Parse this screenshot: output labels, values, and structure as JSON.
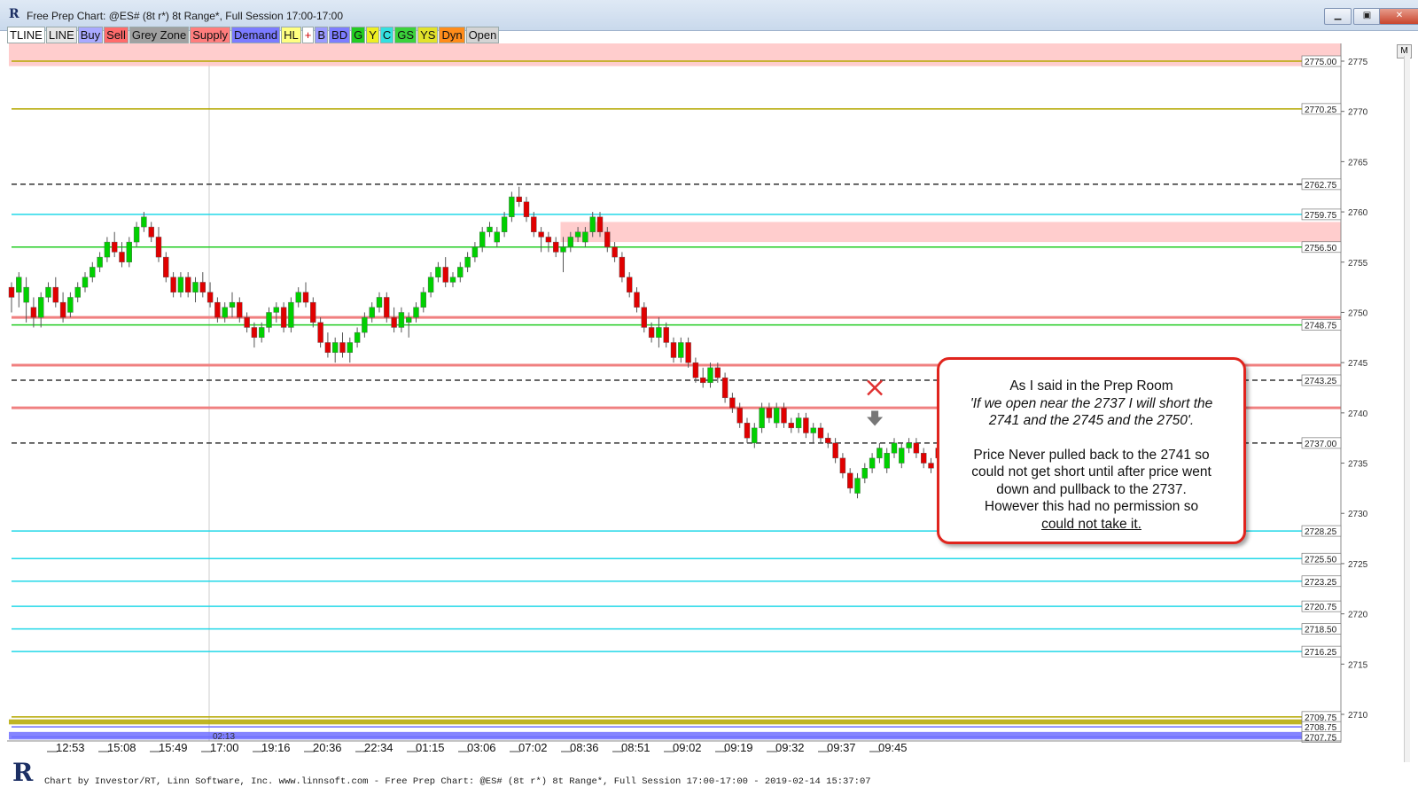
{
  "window": {
    "title": "Free Prep Chart: @ES# (8t r*) 8t Range*, Full Session 17:00-17:00",
    "minimize_label": "▁",
    "maximize_label": "▣",
    "close_label": "✕"
  },
  "toolbar": [
    {
      "label": "TLINE",
      "bg": "#ffffff"
    },
    {
      "label": "LINE",
      "bg": "#e6e6e6"
    },
    {
      "label": "Buy",
      "bg": "#a9a9ff"
    },
    {
      "label": "Sell",
      "bg": "#ff6b6b"
    },
    {
      "label": "Grey Zone",
      "bg": "#a0a0a0"
    },
    {
      "label": "Supply",
      "bg": "#ff7d7d"
    },
    {
      "label": "Demand",
      "bg": "#7b7bff"
    },
    {
      "label": "HL",
      "bg": "#ffff80"
    },
    {
      "label": "+",
      "bg": "#ffffff",
      "fg": "#d00000"
    },
    {
      "label": "B",
      "bg": "#9a9aff"
    },
    {
      "label": "BD",
      "bg": "#7d7dff"
    },
    {
      "label": "G",
      "bg": "#22cc22"
    },
    {
      "label": "Y",
      "bg": "#eeee22"
    },
    {
      "label": "C",
      "bg": "#33e0e0"
    },
    {
      "label": "GS",
      "bg": "#3bd23b"
    },
    {
      "label": "YS",
      "bg": "#e2e22a"
    },
    {
      "label": "Dyn",
      "bg": "#ff8c1a"
    },
    {
      "label": "Open",
      "bg": "#d4d4d4"
    }
  ],
  "m_button": "M",
  "callout": {
    "line1": "As I said in the Prep Room",
    "line2": "'If we open near the 2737 I will short the",
    "line3": "2741 and the 2745 and the 2750'.",
    "line4": "Price Never pulled back to the 2741 so",
    "line5": "could not get short until after price went",
    "line6": "down and pullback to the 2737.",
    "line7": "However this had no permission so",
    "line8": "could not take it."
  },
  "footer": "Chart by Investor/RT, Linn Software, Inc. www.linnsoft.com - Free Prep Chart: @ES# (8t r*) 8t Range*, Full Session 17:00-17:00 - 2019-02-14 15:37:07",
  "chart_data": {
    "type": "candlestick",
    "symbol": "@ES#",
    "ylim": [
      2707,
      2777.5
    ],
    "y_ticks": [
      2710,
      2715,
      2720,
      2725,
      2730,
      2735,
      2740,
      2745,
      2750,
      2755,
      2760,
      2765,
      2770,
      2775
    ],
    "x_tick_labels": [
      "12:53",
      "15:08",
      "15:49",
      "17:00",
      "19:16",
      "20:36",
      "22:34",
      "01:15",
      "03:06",
      "07:02",
      "08:36",
      "08:51",
      "09:02",
      "09:19",
      "09:32",
      "09:37",
      "09:45"
    ],
    "session_marker_label": "02:13",
    "colors": {
      "up": "#00d000",
      "down": "#e00000",
      "wick": "#555555"
    },
    "levels": [
      {
        "price": 2775.0,
        "label": "2775.00",
        "color": "#b5a800",
        "style": "solid"
      },
      {
        "price": 2770.25,
        "label": "2770.25",
        "color": "#b5a800",
        "style": "solid"
      },
      {
        "price": 2762.75,
        "label": "2762.75",
        "color": "#333333",
        "style": "dashed"
      },
      {
        "price": 2759.75,
        "label": "2759.75",
        "color": "#22d8e8",
        "style": "solid"
      },
      {
        "price": 2756.5,
        "label": "2756.50",
        "color": "#333333",
        "style": "dashed"
      },
      {
        "price": 2756.5,
        "label": "",
        "color": "#22cc22",
        "style": "solid"
      },
      {
        "price": 2749.5,
        "label": "",
        "color": "#f08080",
        "style": "solid"
      },
      {
        "price": 2748.75,
        "label": "2748.75",
        "color": "#22cc22",
        "style": "solid"
      },
      {
        "price": 2744.75,
        "label": "",
        "color": "#f08080",
        "style": "solid"
      },
      {
        "price": 2743.25,
        "label": "2743.25",
        "color": "#333333",
        "style": "dashed"
      },
      {
        "price": 2740.5,
        "label": "",
        "color": "#f08080",
        "style": "solid"
      },
      {
        "price": 2737.0,
        "label": "2737.00",
        "color": "#333333",
        "style": "dashed"
      },
      {
        "price": 2728.25,
        "label": "2728.25",
        "color": "#22d8e8",
        "style": "solid"
      },
      {
        "price": 2725.5,
        "label": "2725.50",
        "color": "#22d8e8",
        "style": "solid"
      },
      {
        "price": 2723.25,
        "label": "2723.25",
        "color": "#22d8e8",
        "style": "solid"
      },
      {
        "price": 2720.75,
        "label": "2720.75",
        "color": "#22d8e8",
        "style": "solid"
      },
      {
        "price": 2718.5,
        "label": "2718.50",
        "color": "#22d8e8",
        "style": "solid"
      },
      {
        "price": 2716.25,
        "label": "2716.25",
        "color": "#22d8e8",
        "style": "solid"
      },
      {
        "price": 2709.75,
        "label": "2709.75",
        "color": "#b5a800",
        "style": "solid"
      },
      {
        "price": 2708.75,
        "label": "2708.75",
        "color": "#6e6eff",
        "style": "solid"
      },
      {
        "price": 2707.75,
        "label": "2707.75",
        "color": "#6e6eff",
        "style": "solid"
      }
    ],
    "zones": [
      {
        "from": 2774.5,
        "to": 2777.5,
        "color": "#ffc4c4",
        "start_index": 0
      },
      {
        "from": 2757.0,
        "to": 2759.0,
        "color": "#ffc4c4",
        "start_index": 75
      },
      {
        "from": 2707.5,
        "to": 2708.25,
        "color": "#6e6eff",
        "start_index": 0
      },
      {
        "from": 2709.0,
        "to": 2709.5,
        "color": "#b5a800",
        "start_index": 0
      }
    ],
    "annotations": [
      {
        "type": "x-mark",
        "price": 2742.5,
        "bar_index": 117,
        "color": "#e03030"
      },
      {
        "type": "down-arrow",
        "price": 2739.5,
        "bar_index": 117,
        "color": "#777777"
      }
    ],
    "candles": [
      [
        2752.5,
        2753.0,
        2750.0,
        2751.5
      ],
      [
        2752.0,
        2754.0,
        2750.5,
        2753.5
      ],
      [
        2751.0,
        2753.5,
        2749.0,
        2752.5
      ],
      [
        2750.5,
        2751.5,
        2748.5,
        2749.5
      ],
      [
        2749.5,
        2752.0,
        2748.5,
        2751.5
      ],
      [
        2751.5,
        2753.0,
        2751.0,
        2752.5
      ],
      [
        2752.5,
        2753.5,
        2750.5,
        2751.0
      ],
      [
        2751.0,
        2752.0,
        2749.0,
        2749.5
      ],
      [
        2750.0,
        2752.0,
        2749.5,
        2751.5
      ],
      [
        2751.5,
        2753.0,
        2751.0,
        2752.5
      ],
      [
        2752.5,
        2754.0,
        2752.0,
        2753.5
      ],
      [
        2753.5,
        2755.0,
        2753.0,
        2754.5
      ],
      [
        2754.5,
        2756.0,
        2754.0,
        2755.5
      ],
      [
        2755.5,
        2757.5,
        2755.0,
        2757.0
      ],
      [
        2757.0,
        2758.0,
        2755.5,
        2756.0
      ],
      [
        2756.0,
        2757.0,
        2754.5,
        2755.0
      ],
      [
        2755.0,
        2757.5,
        2754.5,
        2757.0
      ],
      [
        2757.0,
        2759.0,
        2756.5,
        2758.5
      ],
      [
        2758.5,
        2760.0,
        2758.0,
        2759.5
      ],
      [
        2758.5,
        2759.0,
        2757.0,
        2757.5
      ],
      [
        2757.5,
        2758.5,
        2755.0,
        2755.5
      ],
      [
        2755.5,
        2756.0,
        2753.0,
        2753.5
      ],
      [
        2753.5,
        2754.0,
        2751.5,
        2752.0
      ],
      [
        2752.0,
        2754.0,
        2751.5,
        2753.5
      ],
      [
        2753.5,
        2754.0,
        2751.5,
        2752.0
      ],
      [
        2752.0,
        2753.5,
        2751.0,
        2753.0
      ],
      [
        2753.0,
        2754.0,
        2751.5,
        2752.0
      ],
      [
        2752.0,
        2753.0,
        2750.5,
        2751.0
      ],
      [
        2751.0,
        2751.5,
        2749.0,
        2749.5
      ],
      [
        2749.5,
        2751.0,
        2749.0,
        2750.5
      ],
      [
        2750.5,
        2752.0,
        2749.5,
        2751.0
      ],
      [
        2751.0,
        2751.5,
        2749.0,
        2749.5
      ],
      [
        2749.5,
        2750.0,
        2748.0,
        2748.5
      ],
      [
        2748.5,
        2749.0,
        2746.5,
        2747.5
      ],
      [
        2747.5,
        2749.0,
        2747.0,
        2748.5
      ],
      [
        2748.5,
        2750.5,
        2748.0,
        2750.0
      ],
      [
        2750.0,
        2751.0,
        2749.0,
        2750.5
      ],
      [
        2750.5,
        2751.0,
        2748.0,
        2748.5
      ],
      [
        2748.5,
        2751.5,
        2748.0,
        2751.0
      ],
      [
        2751.0,
        2752.5,
        2750.5,
        2752.0
      ],
      [
        2752.0,
        2753.0,
        2750.5,
        2751.0
      ],
      [
        2751.0,
        2751.5,
        2748.5,
        2749.0
      ],
      [
        2749.0,
        2749.5,
        2746.5,
        2747.0
      ],
      [
        2747.0,
        2748.0,
        2745.5,
        2746.0
      ],
      [
        2746.0,
        2747.5,
        2745.0,
        2747.0
      ],
      [
        2747.0,
        2748.0,
        2745.5,
        2746.0
      ],
      [
        2746.0,
        2747.5,
        2745.0,
        2747.0
      ],
      [
        2747.0,
        2748.5,
        2746.5,
        2748.0
      ],
      [
        2748.0,
        2750.0,
        2747.5,
        2749.5
      ],
      [
        2749.5,
        2751.0,
        2749.0,
        2750.5
      ],
      [
        2750.5,
        2752.0,
        2750.0,
        2751.5
      ],
      [
        2751.5,
        2752.0,
        2749.0,
        2749.5
      ],
      [
        2749.5,
        2750.5,
        2748.0,
        2748.5
      ],
      [
        2748.5,
        2750.5,
        2748.0,
        2750.0
      ],
      [
        2749.0,
        2750.0,
        2747.5,
        2749.5
      ],
      [
        2749.5,
        2751.0,
        2749.0,
        2750.5
      ],
      [
        2750.5,
        2752.5,
        2750.0,
        2752.0
      ],
      [
        2752.0,
        2754.0,
        2751.5,
        2753.5
      ],
      [
        2753.5,
        2755.0,
        2753.0,
        2754.5
      ],
      [
        2754.5,
        2755.5,
        2752.5,
        2753.0
      ],
      [
        2753.0,
        2754.0,
        2752.5,
        2753.5
      ],
      [
        2753.5,
        2755.0,
        2753.0,
        2754.5
      ],
      [
        2754.5,
        2756.0,
        2754.0,
        2755.5
      ],
      [
        2755.5,
        2757.0,
        2755.0,
        2756.5
      ],
      [
        2756.5,
        2758.5,
        2756.0,
        2758.0
      ],
      [
        2758.0,
        2759.0,
        2757.5,
        2758.5
      ],
      [
        2757.0,
        2758.5,
        2756.5,
        2758.0
      ],
      [
        2758.0,
        2760.0,
        2757.5,
        2759.5
      ],
      [
        2759.5,
        2762.0,
        2759.0,
        2761.5
      ],
      [
        2761.5,
        2762.5,
        2760.5,
        2761.0
      ],
      [
        2761.0,
        2761.5,
        2759.0,
        2759.5
      ],
      [
        2759.5,
        2760.0,
        2757.5,
        2758.0
      ],
      [
        2758.0,
        2758.5,
        2756.0,
        2757.5
      ],
      [
        2757.5,
        2758.0,
        2756.0,
        2757.0
      ],
      [
        2757.0,
        2757.5,
        2755.5,
        2756.0
      ],
      [
        2756.0,
        2757.5,
        2754.0,
        2756.5
      ],
      [
        2756.5,
        2758.0,
        2756.0,
        2757.5
      ],
      [
        2757.5,
        2758.5,
        2757.0,
        2758.0
      ],
      [
        2757.0,
        2758.5,
        2756.5,
        2758.0
      ],
      [
        2758.0,
        2760.0,
        2757.5,
        2759.5
      ],
      [
        2759.5,
        2760.0,
        2757.5,
        2758.0
      ],
      [
        2758.0,
        2758.5,
        2756.0,
        2756.5
      ],
      [
        2756.5,
        2757.0,
        2755.0,
        2755.5
      ],
      [
        2755.5,
        2756.0,
        2753.0,
        2753.5
      ],
      [
        2753.5,
        2754.0,
        2751.5,
        2752.0
      ],
      [
        2752.0,
        2752.5,
        2750.0,
        2750.5
      ],
      [
        2750.5,
        2751.0,
        2748.0,
        2748.5
      ],
      [
        2748.5,
        2749.0,
        2747.0,
        2747.5
      ],
      [
        2747.5,
        2749.5,
        2746.5,
        2748.5
      ],
      [
        2748.5,
        2749.0,
        2746.5,
        2747.0
      ],
      [
        2747.0,
        2747.5,
        2745.0,
        2745.5
      ],
      [
        2745.5,
        2747.5,
        2745.0,
        2747.0
      ],
      [
        2747.0,
        2747.5,
        2744.5,
        2745.0
      ],
      [
        2745.0,
        2745.5,
        2743.0,
        2743.5
      ],
      [
        2743.5,
        2744.5,
        2742.5,
        2743.0
      ],
      [
        2743.0,
        2745.0,
        2742.5,
        2744.5
      ],
      [
        2744.5,
        2745.0,
        2743.0,
        2743.5
      ],
      [
        2743.5,
        2744.0,
        2741.0,
        2741.5
      ],
      [
        2741.5,
        2742.0,
        2740.0,
        2740.5
      ],
      [
        2740.5,
        2741.0,
        2738.5,
        2739.0
      ],
      [
        2739.0,
        2739.5,
        2737.0,
        2737.5
      ],
      [
        2737.0,
        2739.0,
        2736.5,
        2738.5
      ],
      [
        2738.5,
        2741.0,
        2738.0,
        2740.5
      ],
      [
        2740.5,
        2741.0,
        2739.0,
        2739.5
      ],
      [
        2739.0,
        2741.0,
        2738.5,
        2740.5
      ],
      [
        2740.5,
        2741.0,
        2738.5,
        2739.0
      ],
      [
        2739.0,
        2739.5,
        2738.0,
        2738.5
      ],
      [
        2738.5,
        2740.0,
        2738.0,
        2739.5
      ],
      [
        2739.5,
        2740.0,
        2737.5,
        2738.0
      ],
      [
        2738.0,
        2739.0,
        2737.0,
        2738.5
      ],
      [
        2738.5,
        2739.0,
        2737.0,
        2737.5
      ],
      [
        2737.5,
        2738.0,
        2736.5,
        2737.0
      ],
      [
        2737.0,
        2737.5,
        2735.0,
        2735.5
      ],
      [
        2735.5,
        2736.0,
        2733.5,
        2734.0
      ],
      [
        2734.0,
        2734.5,
        2732.0,
        2732.5
      ],
      [
        2732.0,
        2734.0,
        2731.5,
        2733.5
      ],
      [
        2733.5,
        2735.0,
        2733.0,
        2734.5
      ],
      [
        2734.5,
        2736.0,
        2734.0,
        2735.5
      ],
      [
        2735.5,
        2737.0,
        2735.0,
        2736.5
      ],
      [
        2734.5,
        2736.5,
        2734.0,
        2736.0
      ],
      [
        2736.0,
        2737.5,
        2735.5,
        2737.0
      ],
      [
        2735.0,
        2737.0,
        2734.5,
        2736.5
      ],
      [
        2736.5,
        2737.5,
        2736.0,
        2737.0
      ],
      [
        2737.0,
        2737.5,
        2735.5,
        2736.0
      ],
      [
        2736.0,
        2736.5,
        2734.5,
        2735.0
      ],
      [
        2735.0,
        2735.5,
        2734.0,
        2734.5
      ],
      [
        2736.5,
        2737.0,
        2735.0,
        2735.5
      ],
      [
        2735.5,
        2736.0,
        2734.0,
        2734.5
      ],
      [
        2734.0,
        2734.5,
        2732.5,
        2733.0
      ],
      [
        2733.0,
        2733.5,
        2731.5,
        2732.0
      ],
      [
        2731.5,
        2732.0,
        2730.0,
        2731.5
      ]
    ]
  }
}
